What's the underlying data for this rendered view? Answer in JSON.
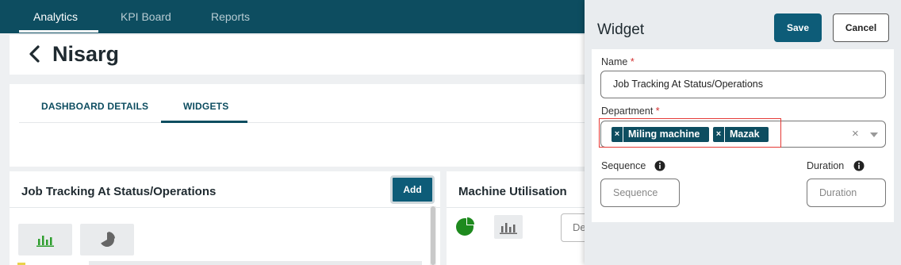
{
  "topnav": {
    "tabs": [
      {
        "label": "Analytics",
        "active": true
      },
      {
        "label": "KPI Board",
        "active": false
      },
      {
        "label": "Reports",
        "active": false
      }
    ]
  },
  "header": {
    "title": "Nisarg",
    "back_icon": "chevron-left-icon"
  },
  "sub_tabs": [
    {
      "label": "DASHBOARD DETAILS",
      "active": false
    },
    {
      "label": "WIDGETS",
      "active": true
    }
  ],
  "widgets": [
    {
      "title": "Job Tracking At Status/Operations",
      "add_label": "Add",
      "icons": [
        "bar-chart-icon",
        "pie-chart-icon"
      ]
    },
    {
      "title": "Machine Utilisation",
      "icons": [
        "pie-chart-icon",
        "bar-chart-icon"
      ],
      "select_value": "De"
    }
  ],
  "panel": {
    "title": "Widget",
    "save_label": "Save",
    "cancel_label": "Cancel",
    "name_label": "Name",
    "name_value": "Job Tracking At Status/Operations",
    "department_label": "Department",
    "department_chips": [
      "Miling machine",
      "Mazak"
    ],
    "chip_remove_glyph": "×",
    "clear_glyph": "×",
    "required_mark": "*",
    "sequence_label": "Sequence",
    "sequence_placeholder": "Sequence",
    "duration_label": "Duration",
    "duration_placeholder": "Duration"
  },
  "colors": {
    "primary": "#0d4d60",
    "button": "#0d5c78",
    "highlight": "#e53935",
    "required": "#d32f2f",
    "chart_green": "#2e9e2e"
  }
}
